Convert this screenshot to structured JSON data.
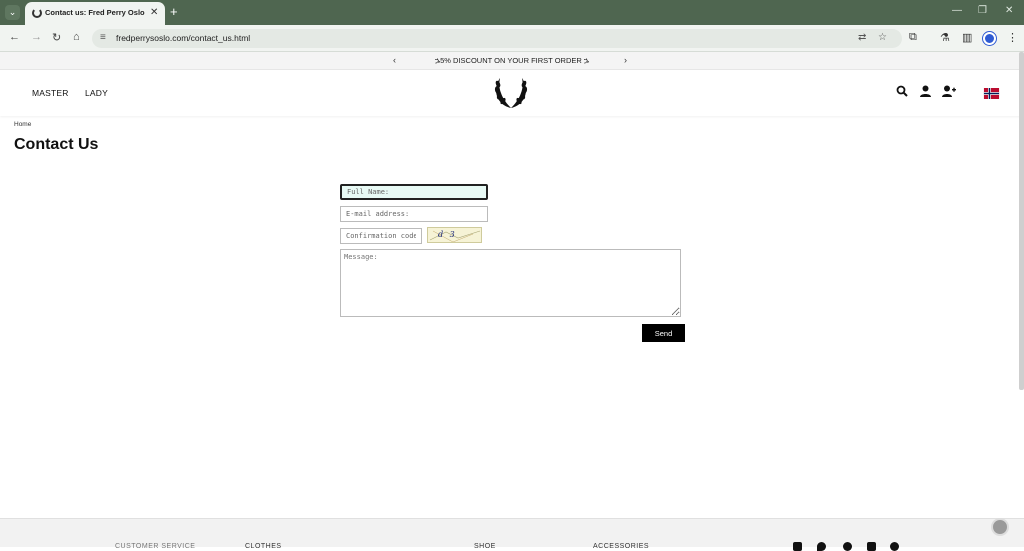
{
  "browser": {
    "tab_title": "Contact us: Fred Perry Oslo Sto",
    "tab_close": "✕",
    "new_tab": "+",
    "url": "fredperrysoslo.com/contact_us.html"
  },
  "promo": {
    "text": "ኌ5% DISCOUNT ON YOUR FIRST ORDER ኌ",
    "prev": "‹",
    "next": "›"
  },
  "header": {
    "nav": [
      "MASTER",
      "LADY"
    ],
    "icons": [
      "search-icon",
      "account-icon",
      "register-icon",
      "norway-flag-icon"
    ]
  },
  "breadcrumb": "Home",
  "page_title": "Contact Us",
  "form": {
    "full_name_placeholder": "Full Name:",
    "email_placeholder": "E-mail address:",
    "code_placeholder": "Confirmation code",
    "captcha_text": "d 3",
    "message_placeholder": "Message:",
    "send_label": "Send"
  },
  "footer": {
    "columns": [
      "CUSTOMER SERVICE",
      "CLOTHES",
      "SHOE",
      "ACCESSORIES"
    ],
    "social_icons": [
      "facebook-icon",
      "twitter-icon",
      "pinterest-icon",
      "tumblr-icon",
      "other-social-icon"
    ]
  },
  "colors": {
    "chrome_frame": "#4f6650",
    "accent_button": "#000000",
    "focus_field_bg": "#e8faf5"
  }
}
